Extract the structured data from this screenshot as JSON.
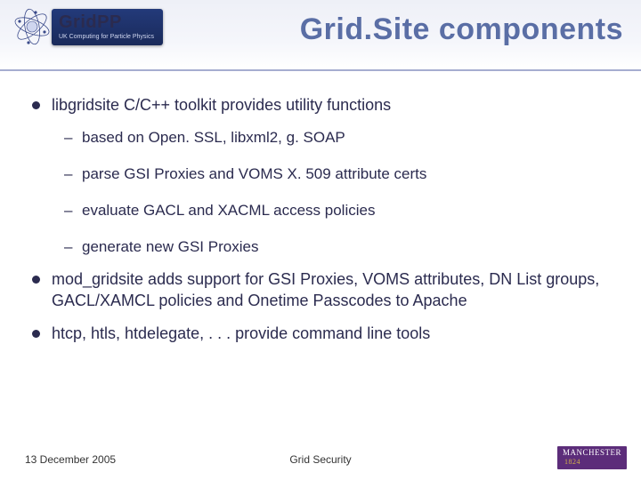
{
  "logo": {
    "name": "GridPP",
    "tagline": "UK Computing for Particle Physics"
  },
  "title": "Grid.Site components",
  "bullets": [
    {
      "text": "libgridsite C/C++ toolkit provides utility functions",
      "sub": [
        "based on Open. SSL, libxml2, g. SOAP",
        "parse GSI Proxies and VOMS X. 509 attribute certs",
        "evaluate GACL and XACML access policies",
        "generate new GSI Proxies"
      ]
    },
    {
      "text": "mod_gridsite adds support for GSI Proxies, VOMS attributes, DN List groups, GACL/XAMCL policies and Onetime Passcodes to Apache"
    },
    {
      "text": "htcp, htls, htdelegate, . . . provide command line tools"
    }
  ],
  "footer": {
    "date": "13 December 2005",
    "center": "Grid Security",
    "org": "MANCHESTER",
    "org_year": "1824"
  }
}
